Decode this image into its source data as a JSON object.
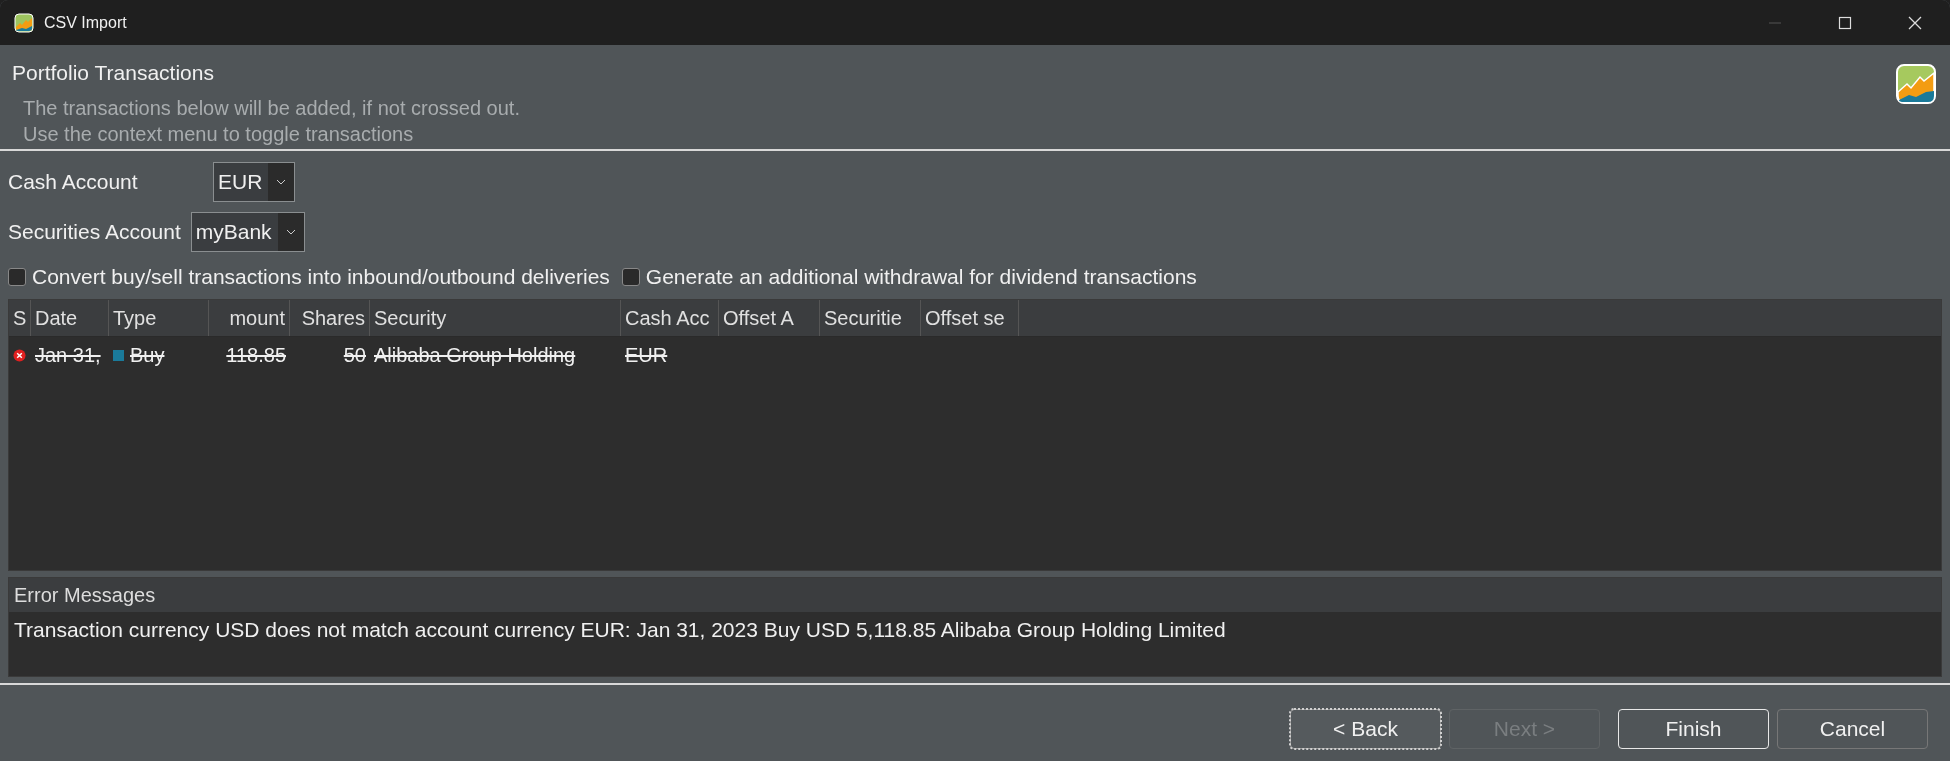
{
  "window": {
    "title": "CSV Import"
  },
  "header": {
    "title": "Portfolio Transactions",
    "lines": [
      "The transactions below will be added, if not crossed out.",
      "Use the context menu to toggle transactions"
    ]
  },
  "fields": [
    {
      "label": "Cash Account",
      "value": "EUR"
    },
    {
      "label": "Securities Account",
      "value": "myBank"
    }
  ],
  "options": [
    {
      "label": "Convert buy/sell transactions into inbound/outbound deliveries",
      "checked": false
    },
    {
      "label": "Generate an additional withdrawal for dividend transactions",
      "checked": false
    }
  ],
  "table": {
    "columns": [
      "S",
      "Date",
      "Type",
      "mount",
      "Shares",
      "Security",
      "Cash Acc",
      "Offset A",
      "Securitie",
      "Offset se"
    ],
    "rows": [
      {
        "error": true,
        "crossed_out": true,
        "color": "#1a7a9a",
        "cells": [
          "",
          "Jan 31,",
          "Buy",
          "118.85",
          "50",
          "Alibaba Group Holding",
          "EUR"
        ]
      }
    ]
  },
  "errors": {
    "title": "Error Messages",
    "messages": [
      "Transaction currency USD does not match account currency EUR: Jan 31, 2023 Buy USD 5,118.85 Alibaba Group Holding Limited"
    ]
  },
  "buttons": [
    {
      "label": "< Back",
      "disabled": false,
      "default": false,
      "focused": true
    },
    {
      "label": "Next >",
      "disabled": true,
      "default": false,
      "focused": false
    },
    {
      "label": "Finish",
      "disabled": false,
      "default": true,
      "focused": false
    },
    {
      "label": "Cancel",
      "disabled": false,
      "default": false,
      "focused": false
    }
  ]
}
